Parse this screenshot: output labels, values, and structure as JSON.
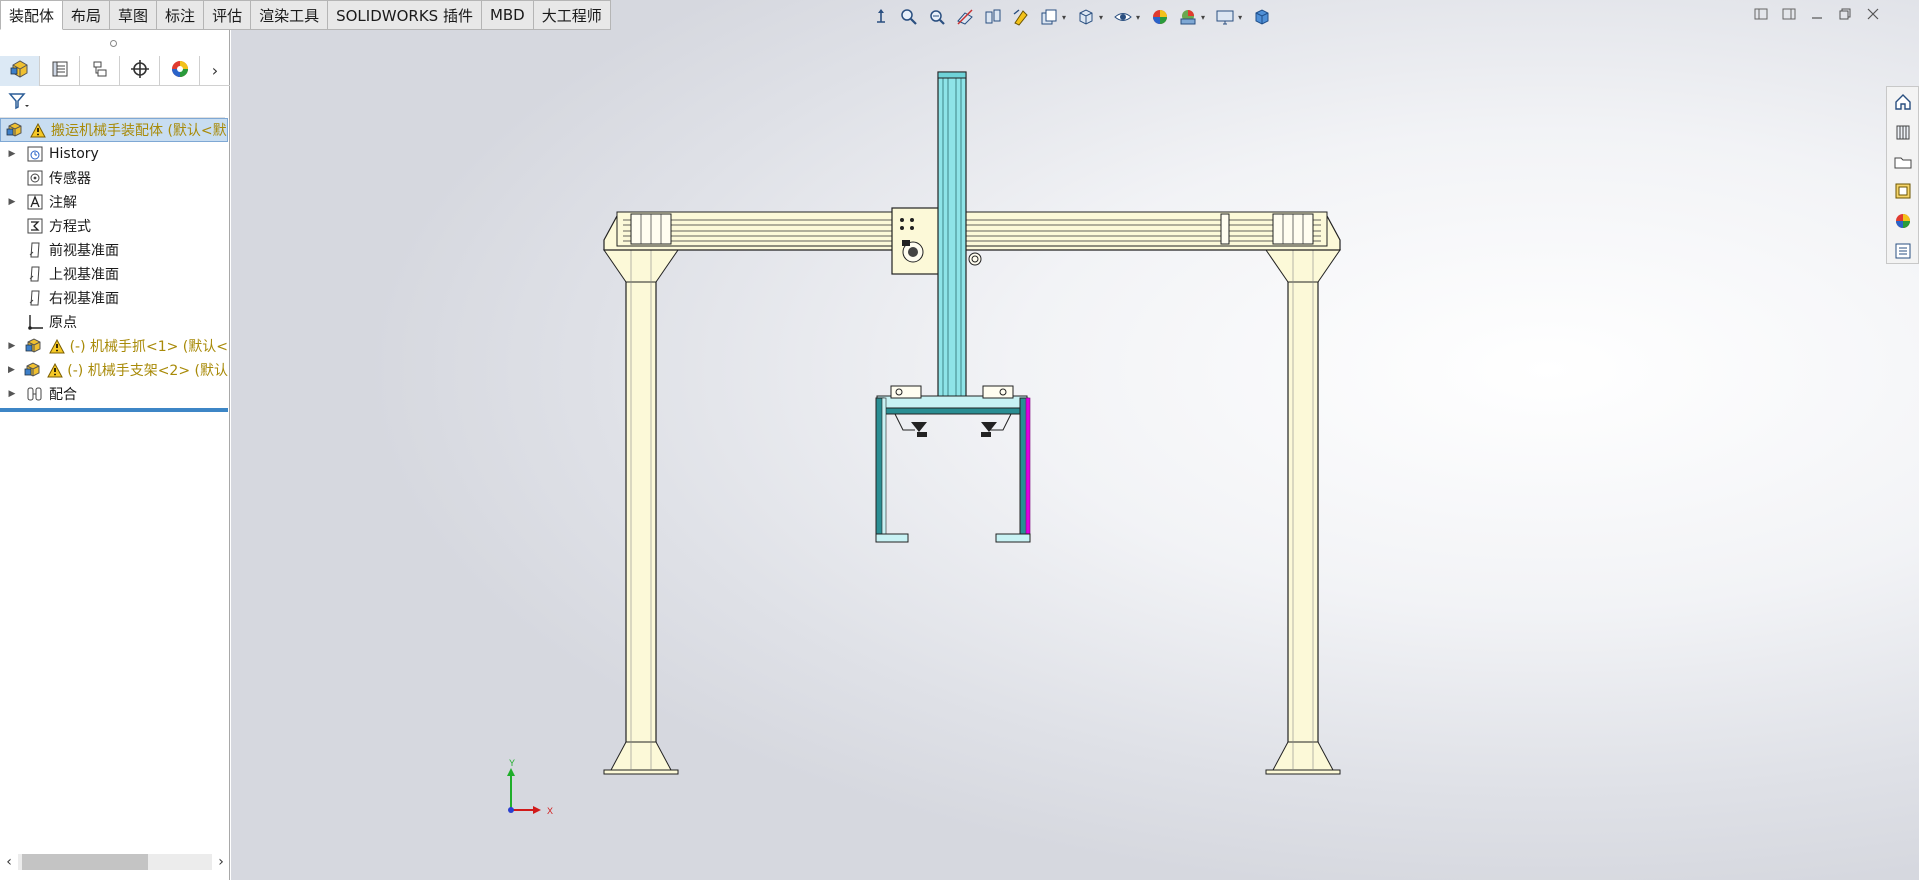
{
  "command_tabs": [
    {
      "label": "装配体",
      "active": true
    },
    {
      "label": "布局",
      "active": false
    },
    {
      "label": "草图",
      "active": false
    },
    {
      "label": "标注",
      "active": false
    },
    {
      "label": "评估",
      "active": false
    },
    {
      "label": "渲染工具",
      "active": false
    },
    {
      "label": "SOLIDWORKS 插件",
      "active": false
    },
    {
      "label": "MBD",
      "active": false
    },
    {
      "label": "大工程师",
      "active": false
    }
  ],
  "manager_tabs": [
    {
      "icon": "featuremanager-icon",
      "active": true
    },
    {
      "icon": "propertymanager-icon",
      "active": false
    },
    {
      "icon": "configurationmanager-icon",
      "active": false
    },
    {
      "icon": "dimxpertmanager-icon",
      "active": false
    },
    {
      "icon": "displaymanager-icon",
      "active": false
    }
  ],
  "tree": {
    "root": {
      "label": "搬运机械手装配体  (默认<默",
      "icon": "assembly-icon",
      "warning": true
    },
    "items": [
      {
        "label": "History",
        "icon": "history-icon",
        "expandable": true
      },
      {
        "label": "传感器",
        "icon": "sensor-icon",
        "expandable": false
      },
      {
        "label": "注解",
        "icon": "annotation-icon",
        "expandable": true
      },
      {
        "label": "方程式",
        "icon": "equation-icon",
        "expandable": false
      },
      {
        "label": "前视基准面",
        "icon": "plane-icon",
        "expandable": false
      },
      {
        "label": "上视基准面",
        "icon": "plane-icon",
        "expandable": false
      },
      {
        "label": "右视基准面",
        "icon": "plane-icon",
        "expandable": false
      },
      {
        "label": "原点",
        "icon": "origin-icon",
        "expandable": false
      },
      {
        "label": "(-) 机械手抓<1> (默认<",
        "icon": "subassembly-icon",
        "expandable": true,
        "warning": true,
        "gold": true
      },
      {
        "label": "(-) 机械手支架<2> (默认",
        "icon": "subassembly-icon",
        "expandable": true,
        "warning": true,
        "gold": true
      },
      {
        "label": "配合",
        "icon": "mates-icon",
        "expandable": true
      }
    ]
  },
  "view_toolbar": [
    "zoom-to-fit-icon",
    "zoom-area-icon",
    "previous-view-icon",
    "section-view-icon",
    "dynamic-annotation-icon",
    "view-palette-icon",
    "view-orientation-icon",
    "display-style-icon",
    "hide-show-icon",
    "edit-appearance-icon",
    "apply-scene-icon",
    "view-settings-icon",
    "display-cube-icon"
  ],
  "task_pane": [
    "home-icon",
    "design-library-icon",
    "file-explorer-icon",
    "view-palette-icon",
    "appearances-icon",
    "custom-properties-icon"
  ],
  "triad": {
    "x_label": "X",
    "y_label": "Y",
    "x_color": "#d11a1a",
    "y_color": "#1fae2a",
    "z_color": "#2a3fd0"
  },
  "model_colors": {
    "frame": "#fcf9d8",
    "column": "#8ee4e8",
    "gripper": "#2a8e93",
    "edge": "#222222",
    "highlight": "#e000e0"
  }
}
